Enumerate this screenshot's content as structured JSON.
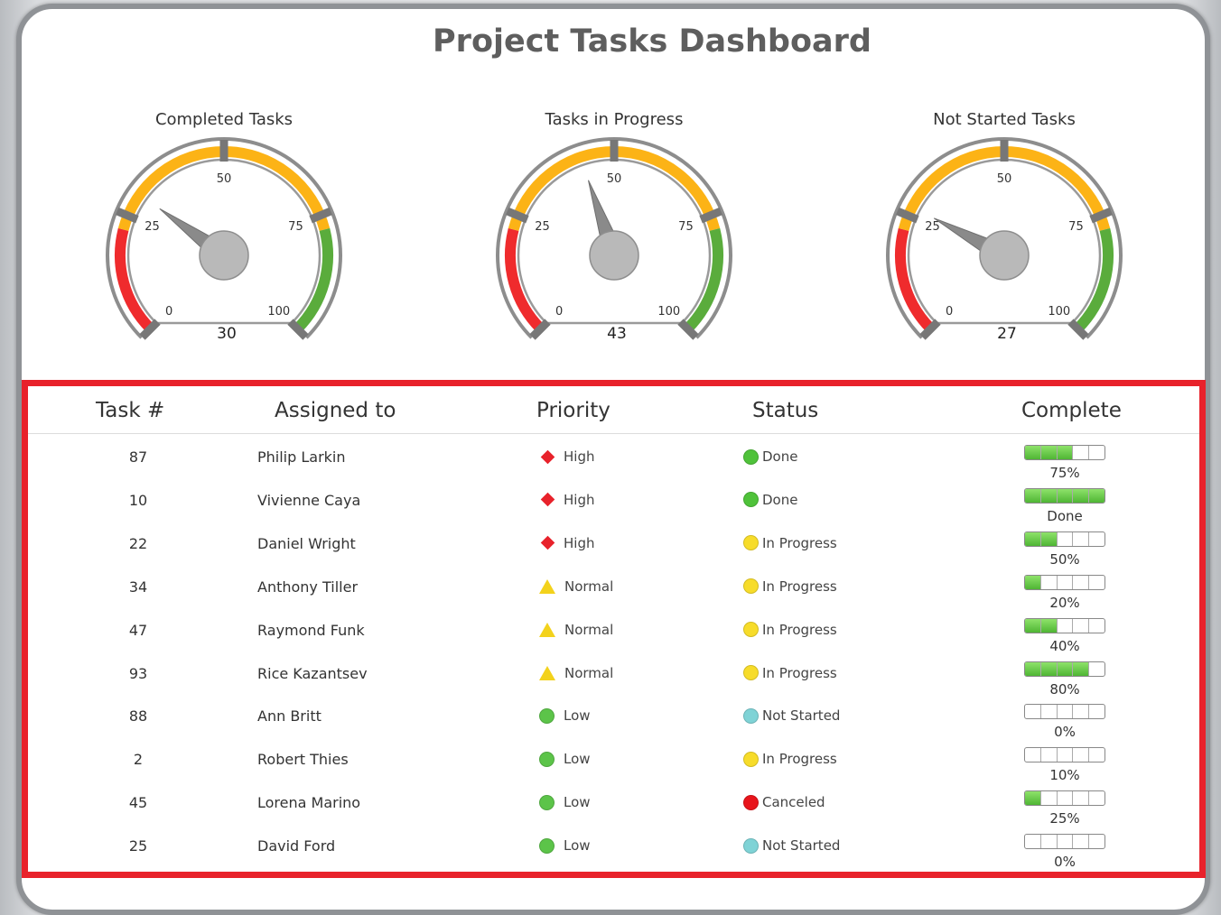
{
  "title": "Project Tasks Dashboard",
  "gauges": [
    {
      "title": "Completed Tasks",
      "value": 30,
      "ticks": [
        "0",
        "25",
        "50",
        "75",
        "100"
      ]
    },
    {
      "title": "Tasks in Progress",
      "value": 43,
      "ticks": [
        "0",
        "25",
        "50",
        "75",
        "100"
      ]
    },
    {
      "title": "Not Started Tasks",
      "value": 27,
      "ticks": [
        "0",
        "25",
        "50",
        "75",
        "100"
      ]
    }
  ],
  "gauge_colors": {
    "low": "#ef2b2d",
    "mid": "#fcb316",
    "high": "#5aac3c"
  },
  "table": {
    "headers": [
      "Task #",
      "Assigned to",
      "Priority",
      "Status",
      "Complete"
    ],
    "rows": [
      {
        "task": "87",
        "assigned": "Philip Larkin",
        "priority": "High",
        "priority_icon": "red-diamond-icon",
        "status": "Done",
        "status_color": "#4fc23a",
        "complete": 0.75,
        "complete_label": "75%"
      },
      {
        "task": "10",
        "assigned": "Vivienne Caya",
        "priority": "High",
        "priority_icon": "red-diamond-icon",
        "status": "Done",
        "status_color": "#4fc23a",
        "complete": 1.0,
        "complete_label": "Done"
      },
      {
        "task": "22",
        "assigned": "Daniel Wright",
        "priority": "High",
        "priority_icon": "red-diamond-icon",
        "status": "In Progress",
        "status_color": "#f7dc2a",
        "complete": 0.5,
        "complete_label": "50%"
      },
      {
        "task": "34",
        "assigned": "Anthony Tiller",
        "priority": "Normal",
        "priority_icon": "yellow-triangle-icon",
        "status": "In Progress",
        "status_color": "#f7dc2a",
        "complete": 0.2,
        "complete_label": "20%"
      },
      {
        "task": "47",
        "assigned": "Raymond Funk",
        "priority": "Normal",
        "priority_icon": "yellow-triangle-icon",
        "status": "In Progress",
        "status_color": "#f7dc2a",
        "complete": 0.4,
        "complete_label": "40%"
      },
      {
        "task": "93",
        "assigned": "Rice Kazantsev",
        "priority": "Normal",
        "priority_icon": "yellow-triangle-icon",
        "status": "In Progress",
        "status_color": "#f7dc2a",
        "complete": 0.8,
        "complete_label": "80%"
      },
      {
        "task": "88",
        "assigned": "Ann Britt",
        "priority": "Low",
        "priority_icon": "green-circle-icon",
        "status": "Not Started",
        "status_color": "#7fd3d6",
        "complete": 0.0,
        "complete_label": "0%"
      },
      {
        "task": "2",
        "assigned": "Robert Thies",
        "priority": "Low",
        "priority_icon": "green-circle-icon",
        "status": "In Progress",
        "status_color": "#f7dc2a",
        "complete": 0.1,
        "complete_label": "10%"
      },
      {
        "task": "45",
        "assigned": "Lorena Marino",
        "priority": "Low",
        "priority_icon": "green-circle-icon",
        "status": "Canceled",
        "status_color": "#e8141b",
        "complete": 0.25,
        "complete_label": "25%"
      },
      {
        "task": "25",
        "assigned": "David Ford",
        "priority": "Low",
        "priority_icon": "green-circle-icon",
        "status": "Not Started",
        "status_color": "#7fd3d6",
        "complete": 0.0,
        "complete_label": "0%"
      }
    ]
  }
}
